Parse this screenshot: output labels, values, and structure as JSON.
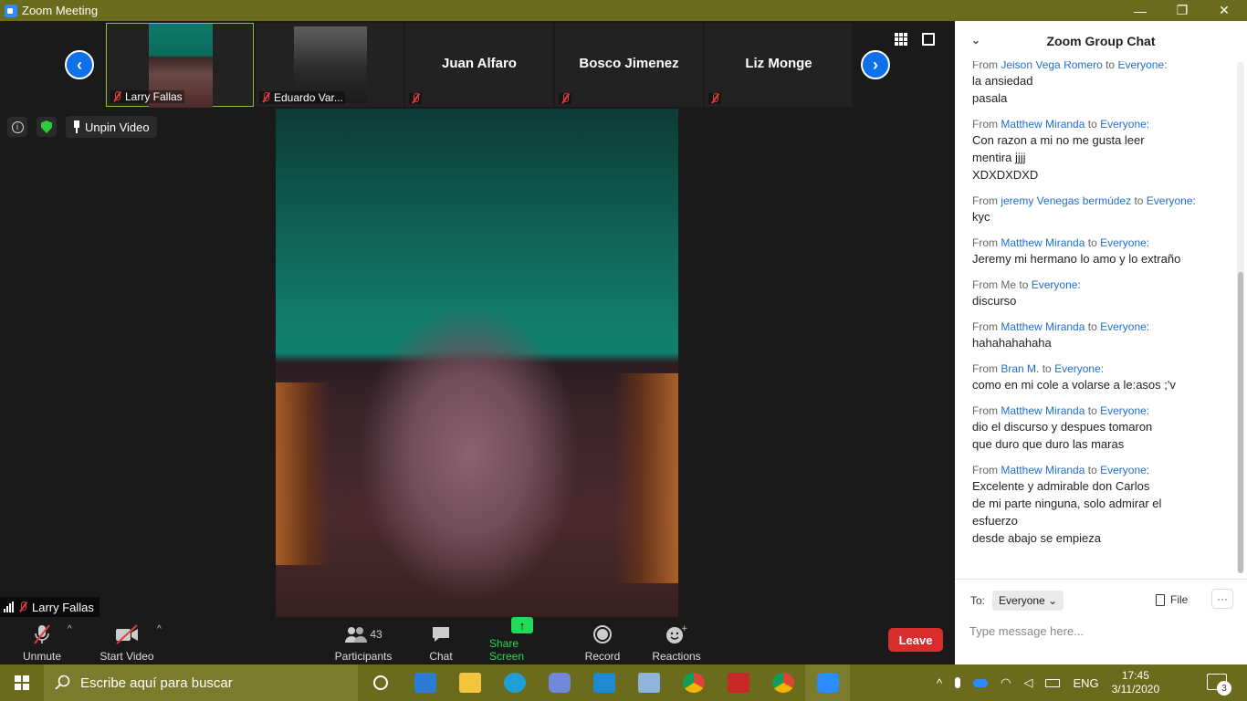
{
  "window": {
    "title": "Zoom Meeting",
    "minimize": "—",
    "restore": "❐",
    "close": "✕"
  },
  "gallery": {
    "thumbnails": [
      {
        "name": "Larry Fallas",
        "has_video": true
      },
      {
        "name": "Eduardo Var...",
        "has_video": true
      },
      {
        "name": "Juan Alfaro",
        "has_video": false
      },
      {
        "name": "Bosco Jimenez",
        "has_video": false
      },
      {
        "name": "Liz Monge",
        "has_video": false
      }
    ],
    "prev_arrow": "‹",
    "next_arrow": "›"
  },
  "video": {
    "unpin_label": "Unpin Video",
    "info_glyph": "i",
    "speaker_name": "Larry Fallas"
  },
  "toolbar": {
    "unmute": "Unmute",
    "start_video": "Start Video",
    "participants": "Participants",
    "participant_count": "43",
    "chat": "Chat",
    "share_screen": "Share Screen",
    "record": "Record",
    "reactions": "Reactions",
    "leave": "Leave",
    "caret": "^"
  },
  "chat": {
    "title": "Zoom Group Chat",
    "collapse_glyph": "⌄",
    "messages": [
      {
        "sender": "Jeison Vega Romero",
        "recipient": "Everyone:",
        "lines": [
          "la ansiedad",
          "pasala"
        ]
      },
      {
        "sender": "Matthew Miranda",
        "recipient": "Everyone:",
        "lines": [
          "Con razon a mi no me gusta leer",
          "mentira jjjj",
          "XDXDXDXD"
        ]
      },
      {
        "sender": "jeremy Venegas bermúdez",
        "recipient": "Everyone:",
        "lines": [
          "kyc"
        ]
      },
      {
        "sender": "Matthew Miranda",
        "recipient": "Everyone:",
        "lines": [
          "Jeremy mi hermano lo amo y lo extraño"
        ]
      },
      {
        "sender": "Me",
        "recipient": "Everyone:",
        "lines": [
          "discurso"
        ]
      },
      {
        "sender": "Matthew Miranda",
        "recipient": "Everyone:",
        "lines": [
          "hahahahahaha"
        ]
      },
      {
        "sender": "Bran M.",
        "recipient": "Everyone:",
        "lines": [
          "como en mi cole a volarse a le:asos ;'v"
        ]
      },
      {
        "sender": "Matthew Miranda",
        "recipient": "Everyone:",
        "lines": [
          "dio el discurso y despues tomaron",
          "que duro que duro las maras"
        ]
      },
      {
        "sender": "Matthew Miranda",
        "recipient": "Everyone:",
        "lines": [
          "Excelente y admirable don Carlos",
          "de mi parte ninguna, solo admirar el",
          "esfuerzo",
          "desde abajo se empieza"
        ]
      }
    ],
    "from_word": "From",
    "to_word": "to",
    "to_label": "To:",
    "to_value": "Everyone",
    "file_label": "File",
    "more_label": "···",
    "input_placeholder": "Type message here..."
  },
  "taskbar": {
    "search_placeholder": "Escribe aquí para buscar",
    "apps": [
      "task-view",
      "mail",
      "file-explorer",
      "edge",
      "discord",
      "vscode",
      "virtualbox",
      "chrome",
      "app-red",
      "chrome-user",
      "zoom"
    ],
    "language": "ENG",
    "time": "17:45",
    "date": "3/11/2020",
    "notification_count": "3"
  },
  "colors": {
    "title_bar": "#6b6b1e",
    "zoom_blue": "#0e71eb",
    "share_green": "#23d959",
    "leave_red": "#d82d2d",
    "chat_name_blue": "#1f6fd1"
  }
}
